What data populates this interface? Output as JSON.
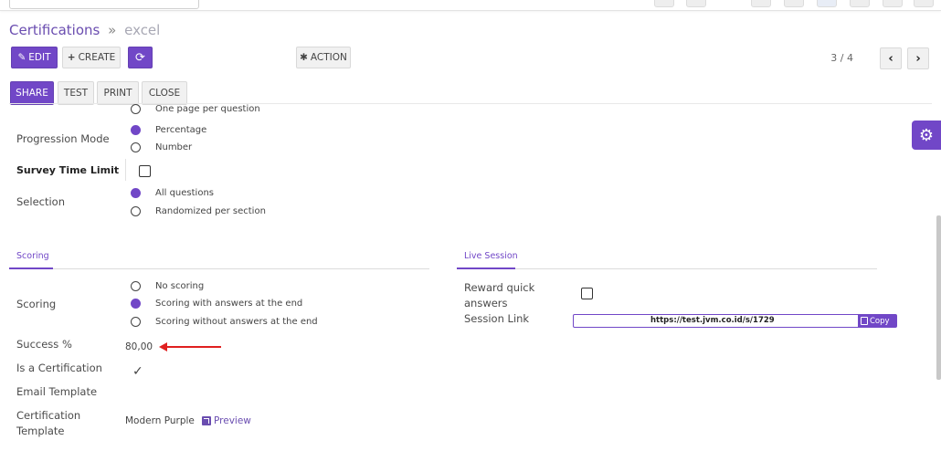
{
  "breadcrumb": {
    "root": "Certifications",
    "separator": "»",
    "current": "excel"
  },
  "toolbar": {
    "edit_label": "EDIT",
    "create_label": "CREATE",
    "action_label": "ACTION",
    "pager": "3 / 4",
    "prev_icon": "chevron-left",
    "next_icon": "chevron-right"
  },
  "statusbar": {
    "share_label": "SHARE",
    "test_label": "TEST",
    "print_label": "PRINT",
    "close_label": "CLOSE"
  },
  "layout_section": {
    "partial_option": "One page per question"
  },
  "progression": {
    "label": "Progression Mode",
    "options": [
      {
        "label": "Percentage",
        "checked": true
      },
      {
        "label": "Number",
        "checked": false
      }
    ]
  },
  "time_limit": {
    "label": "Survey Time Limit",
    "checked": false
  },
  "selection": {
    "label": "Selection",
    "options": [
      {
        "label": "All questions",
        "checked": true
      },
      {
        "label": "Randomized per section",
        "checked": false
      }
    ]
  },
  "scoring_section": {
    "title": "Scoring",
    "scoring_label": "Scoring",
    "options": [
      {
        "label": "No scoring",
        "checked": false
      },
      {
        "label": "Scoring with answers at the end",
        "checked": true
      },
      {
        "label": "Scoring without answers at the end",
        "checked": false
      }
    ],
    "success_label": "Success %",
    "success_value": "80,00",
    "certification_label": "Is a Certification",
    "certification_checked": true,
    "email_template_label": "Email Template",
    "cert_template_label_1": "Certification",
    "cert_template_label_2": "Template",
    "cert_template_value": "Modern Purple",
    "preview_label": "Preview"
  },
  "live_session": {
    "title": "Live Session",
    "reward_label_1": "Reward quick",
    "reward_label_2": "answers",
    "reward_checked": false,
    "session_link_label": "Session Link",
    "session_link_value": "https://test.jvm.co.id/s/1729",
    "copy_label": "Copy"
  },
  "colors": {
    "accent": "#7147c7",
    "annotation_arrow": "#e02020"
  }
}
